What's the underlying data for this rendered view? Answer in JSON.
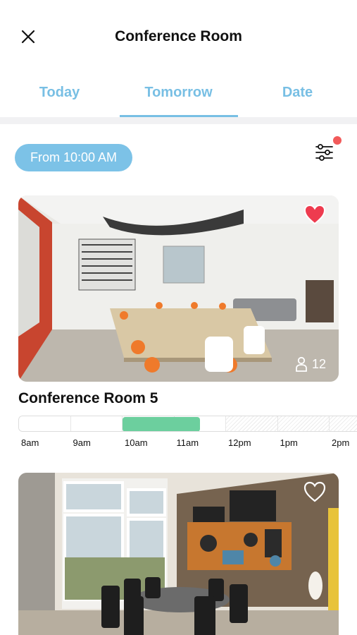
{
  "header": {
    "title": "Conference Room",
    "close_icon": "close-icon"
  },
  "tabs": [
    {
      "label": "Today",
      "active": false
    },
    {
      "label": "Tomorrow",
      "active": true
    },
    {
      "label": "Date",
      "active": false
    }
  ],
  "filter": {
    "from_label": "From 10:00 AM",
    "icon": "sliders-icon",
    "has_notification": true
  },
  "colors": {
    "accent": "#78bfe4",
    "chip": "#7cc2e7",
    "booked": "#6ccf9e",
    "heart_active": "#ee3b4f",
    "notification": "#f25a5a"
  },
  "rooms": [
    {
      "name": "Conference Room 5",
      "capacity": "12",
      "favorite": true,
      "timeline": {
        "ticks": [
          "8am",
          "9am",
          "10am",
          "11am",
          "12pm",
          "1pm",
          "2pm"
        ],
        "booked_from_hour": 10,
        "booked_to_hour": 11.5,
        "past_until_hour": 12
      }
    },
    {
      "favorite": false
    }
  ]
}
